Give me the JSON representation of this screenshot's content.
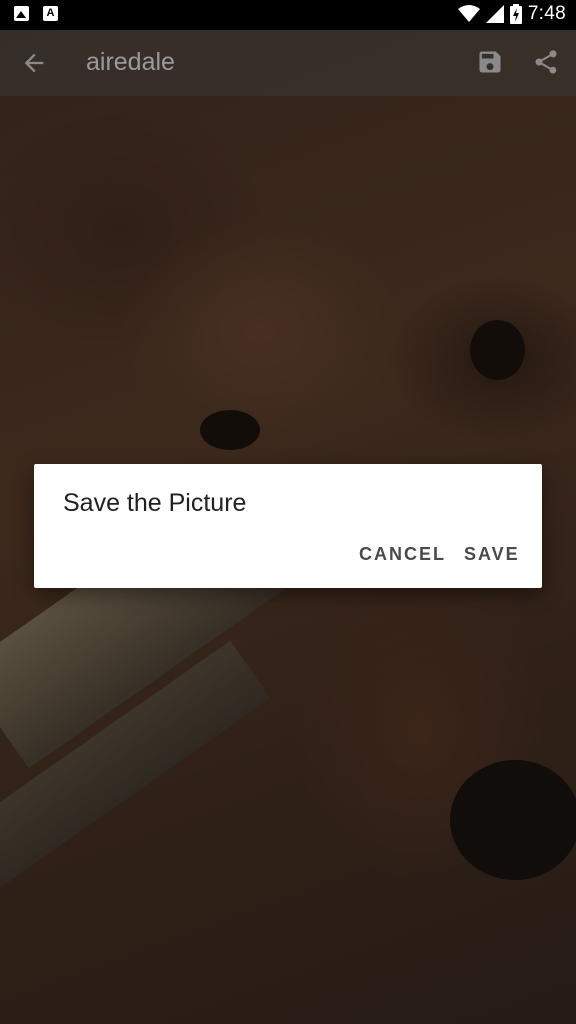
{
  "status_bar": {
    "time": "7:48",
    "icons": [
      "image-notification-icon",
      "a-notification-icon",
      "wifi-icon",
      "cellular-signal-icon",
      "battery-charging-icon"
    ]
  },
  "app_bar": {
    "title": "airedale",
    "icons": [
      "back-arrow-icon",
      "save-icon",
      "share-icon"
    ]
  },
  "dialog": {
    "title": "Save the Picture",
    "cancel_label": "CANCEL",
    "save_label": "SAVE"
  }
}
